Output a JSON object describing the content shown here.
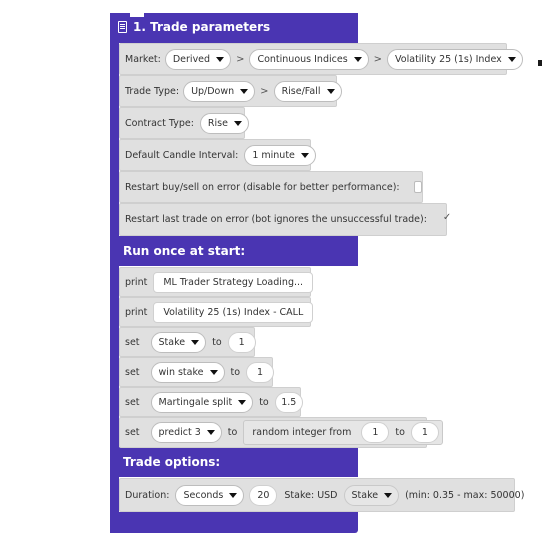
{
  "trade_parameters": {
    "title": "1. Trade parameters",
    "market_label": "Market:",
    "market": [
      "Derived",
      "Continuous Indices",
      "Volatility 25 (1s) Index"
    ],
    "separator": ">",
    "trade_type_label": "Trade Type:",
    "trade_type": [
      "Up/Down",
      "Rise/Fall"
    ],
    "contract_type_label": "Contract Type:",
    "contract_type": "Rise",
    "candle_label": "Default Candle Interval:",
    "candle_interval": "1 minute",
    "restart_buy_label": "Restart buy/sell on error (disable for better performance):",
    "restart_buy_checked": false,
    "restart_last_label": "Restart last trade on error (bot ignores the unsuccessful trade):",
    "restart_last_checked": true
  },
  "run_once": {
    "title": "Run once at start:",
    "print_kw": "print",
    "set_kw": "set",
    "to_kw": "to",
    "print1": "ML Trader Strategy Loading...",
    "print2": "Volatility 25 (1s) Index - CALL",
    "sets": [
      {
        "var": "Stake",
        "value": "1"
      },
      {
        "var": "win stake",
        "value": "1"
      },
      {
        "var": "Martingale split",
        "value": "1.5"
      }
    ],
    "random": {
      "var": "predict 3",
      "label": "random integer from",
      "from": "1",
      "to": "1"
    }
  },
  "trade_options": {
    "title": "Trade options:",
    "duration_label": "Duration:",
    "duration_unit": "Seconds",
    "duration_value": "20",
    "stake_label": "Stake: USD",
    "stake_type": "Stake",
    "range_text": "(min: 0.35 - max: 50000)"
  },
  "colors": {
    "block": "#4a35b2",
    "row": "#e0e0e0"
  }
}
